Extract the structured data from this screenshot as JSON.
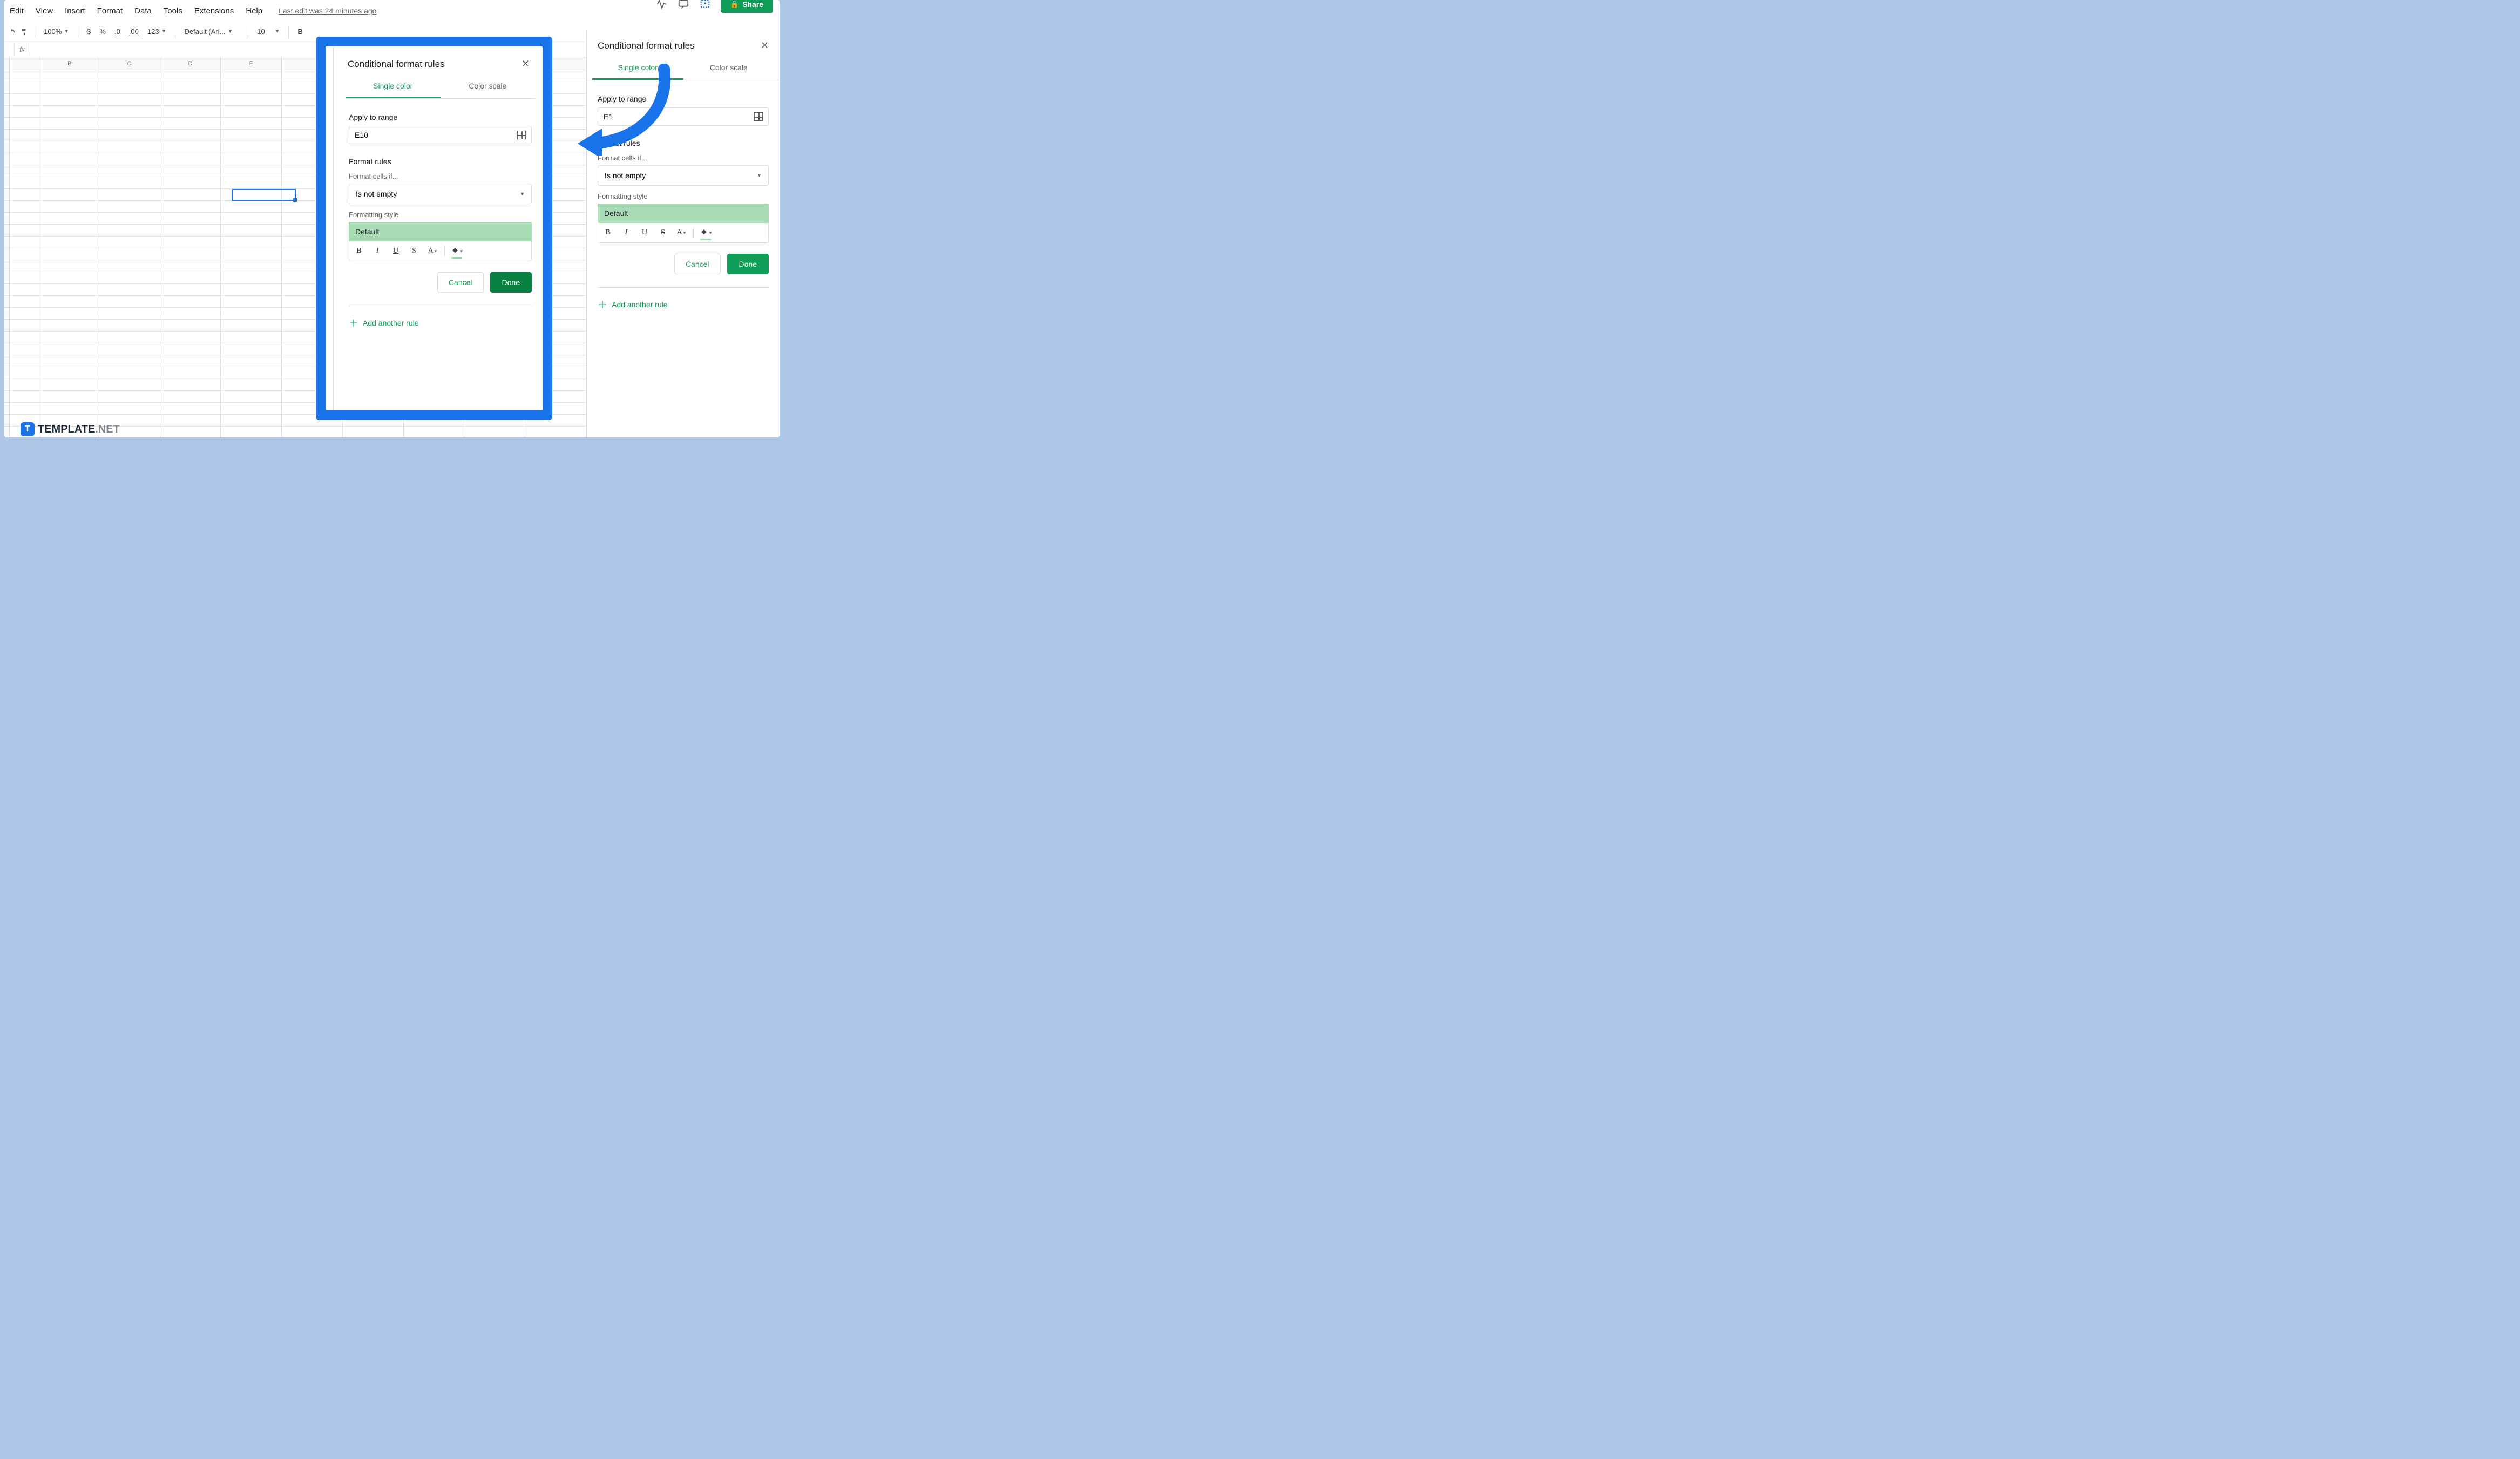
{
  "menus": {
    "edit": "Edit",
    "view": "View",
    "insert": "Insert",
    "format": "Format",
    "data": "Data",
    "tools": "Tools",
    "extensions": "Extensions",
    "help": "Help",
    "last_edit": "Last edit was 24 minutes ago"
  },
  "share_label": "Share",
  "toolbar": {
    "zoom": "100%",
    "currency": "$",
    "percent": "%",
    "dec_dec": ".0",
    "inc_dec": ".00",
    "num_fmt": "123",
    "font": "Default (Ari...",
    "font_size": "10",
    "bold": "B"
  },
  "columns": [
    "B",
    "C",
    "D",
    "E"
  ],
  "formula": {
    "fx": "fx"
  },
  "right_panel": {
    "title": "Conditional format rules",
    "tab_single": "Single color",
    "tab_scale": "Color scale",
    "apply_label": "Apply to range",
    "range_value": "E1",
    "rules_label": "Format rules",
    "cells_if_label": "Format cells if...",
    "condition": "Is not empty",
    "style_label": "Formatting style",
    "style_preview": "Default",
    "cancel": "Cancel",
    "done": "Done",
    "add_rule": "Add another rule"
  },
  "popup": {
    "title": "Conditional format rules",
    "tab_single": "Single color",
    "tab_scale": "Color scale",
    "apply_label": "Apply to range",
    "range_value": "E10",
    "rules_label": "Format rules",
    "cells_if_label": "Format cells if...",
    "condition": "Is not empty",
    "style_label": "Formatting style",
    "style_preview": "Default",
    "cancel": "Cancel",
    "done": "Done",
    "add_rule": "Add another rule"
  },
  "fmt_buttons": {
    "bold": "B",
    "italic": "I",
    "underline": "U",
    "strike": "S",
    "textcolor": "A",
    "fill": "⬙"
  },
  "watermark": {
    "t": "T",
    "name": "TEMPLATE",
    "net": ".NET"
  }
}
